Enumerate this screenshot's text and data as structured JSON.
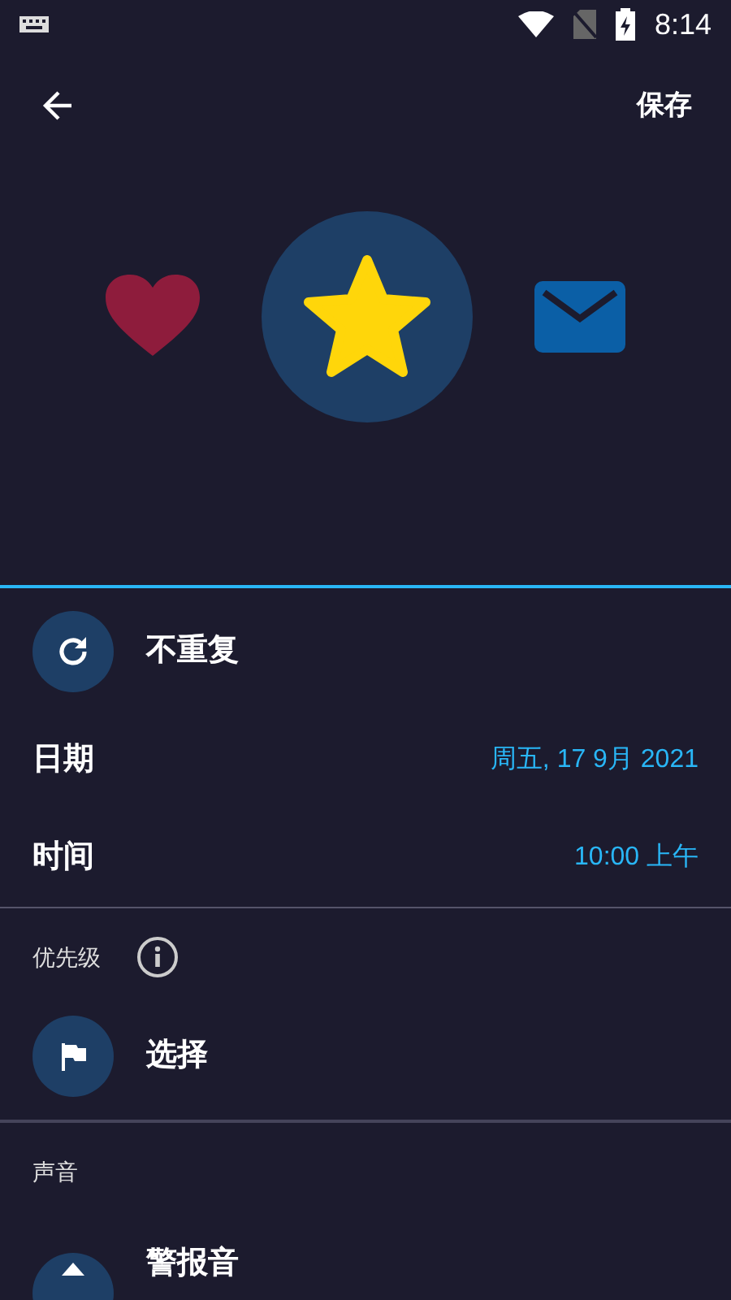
{
  "status_bar": {
    "time": "8:14"
  },
  "toolbar": {
    "save": "保存"
  },
  "icon_choices": [
    {
      "kind": "heart",
      "selected": false
    },
    {
      "kind": "star",
      "selected": true
    },
    {
      "kind": "mail",
      "selected": false
    }
  ],
  "repeat": {
    "label": "不重复"
  },
  "date": {
    "label": "日期",
    "value": "周五, 17 9月 2021"
  },
  "time": {
    "label": "时间",
    "value": "10:00 上午"
  },
  "priority": {
    "heading": "优先级",
    "value": "选择"
  },
  "sound": {
    "heading": "声音",
    "value": "警报音"
  }
}
